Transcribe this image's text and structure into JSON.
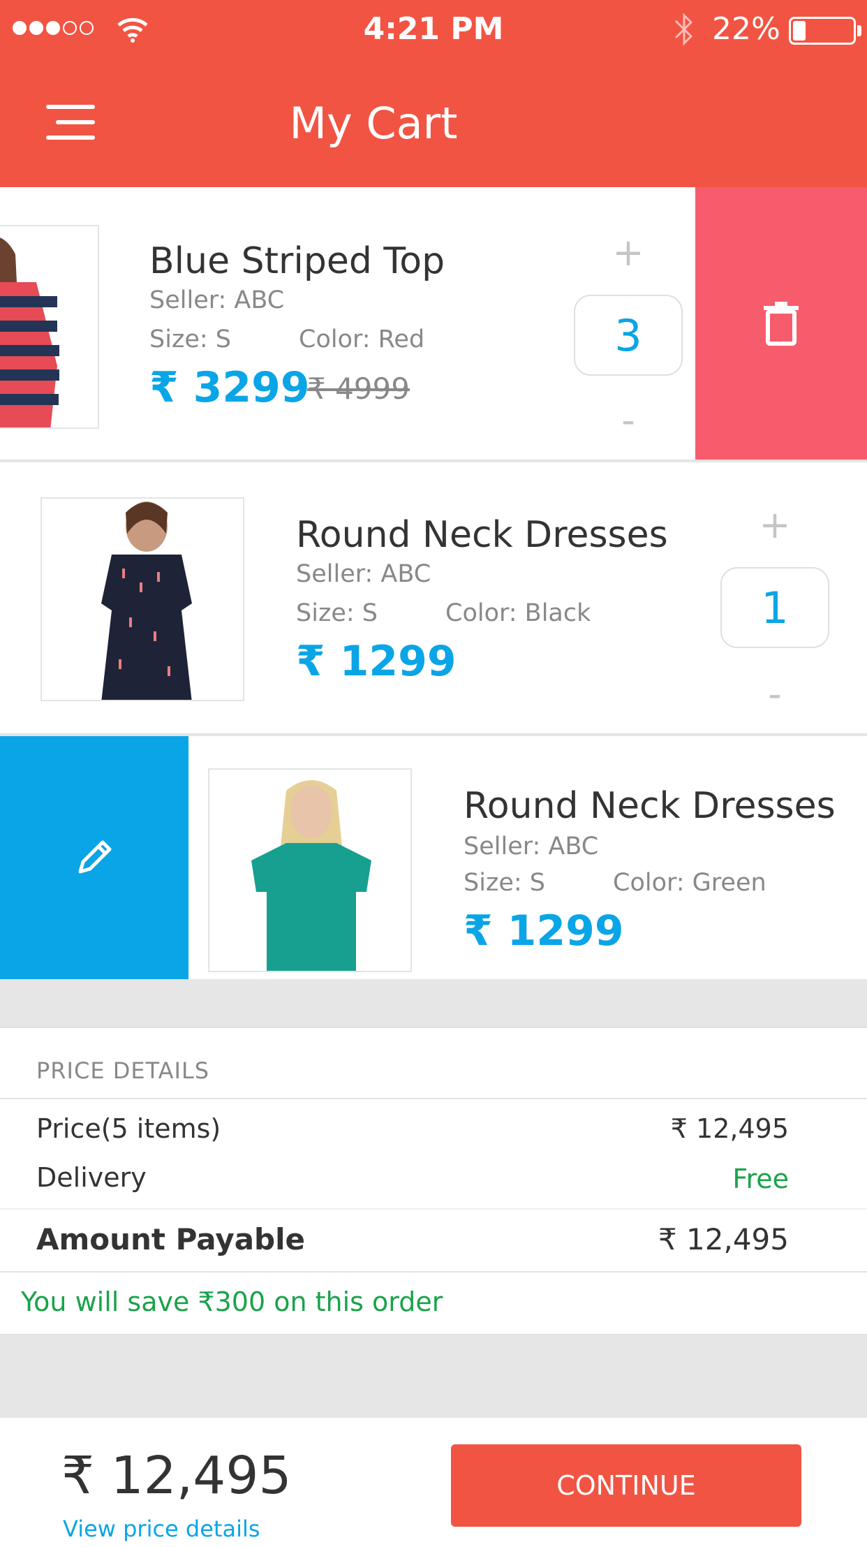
{
  "status_bar": {
    "time": "4:21 PM",
    "battery": "22%",
    "battery_level": 0.22,
    "signal_bars_filled": 3,
    "signal_bars_total": 5
  },
  "header": {
    "title": "My Cart",
    "menu_icon": "hamburger-menu-icon",
    "background_color": "#f25443"
  },
  "cart": {
    "items": [
      {
        "name": "Blue Striped Top",
        "seller": "Seller: ABC",
        "size": "Size:  S",
        "color": "Color:  Red",
        "price": "₹ 3299",
        "old_price": "₹ 4999",
        "quantity": "3",
        "plus": "+",
        "minus": "-",
        "action": "delete",
        "action_icon": "trash-icon"
      },
      {
        "name": "Round Neck Dresses",
        "seller": "Seller: ABC",
        "size": "Size:  S",
        "color": "Color:  Black",
        "price": "₹ 1299",
        "quantity": "1",
        "plus": "+",
        "minus": "-"
      },
      {
        "name": "Round Neck Dresses",
        "seller": "Seller: ABC",
        "size": "Size:  S",
        "color": "Color:  Green",
        "price": "₹ 1299",
        "action": "edit",
        "action_icon": "pencil-icon"
      }
    ]
  },
  "price_details": {
    "title": "PRICE DETAILS",
    "price_label": "Price(5 items)",
    "price_value": "₹ 12,495",
    "delivery_label": "Delivery",
    "delivery_value": "Free",
    "payable_label": "Amount Payable",
    "payable_value": "₹ 12,495",
    "savings_text": "You will save ₹300 on this order"
  },
  "footer": {
    "total": "₹ 12,495",
    "view_details": "View price details",
    "continue_label": "CONTINUE"
  },
  "colors": {
    "accent": "#f25443",
    "price_blue": "#0aa5e6",
    "delete_red": "#f75c6c",
    "savings_green": "#1aa34a"
  }
}
